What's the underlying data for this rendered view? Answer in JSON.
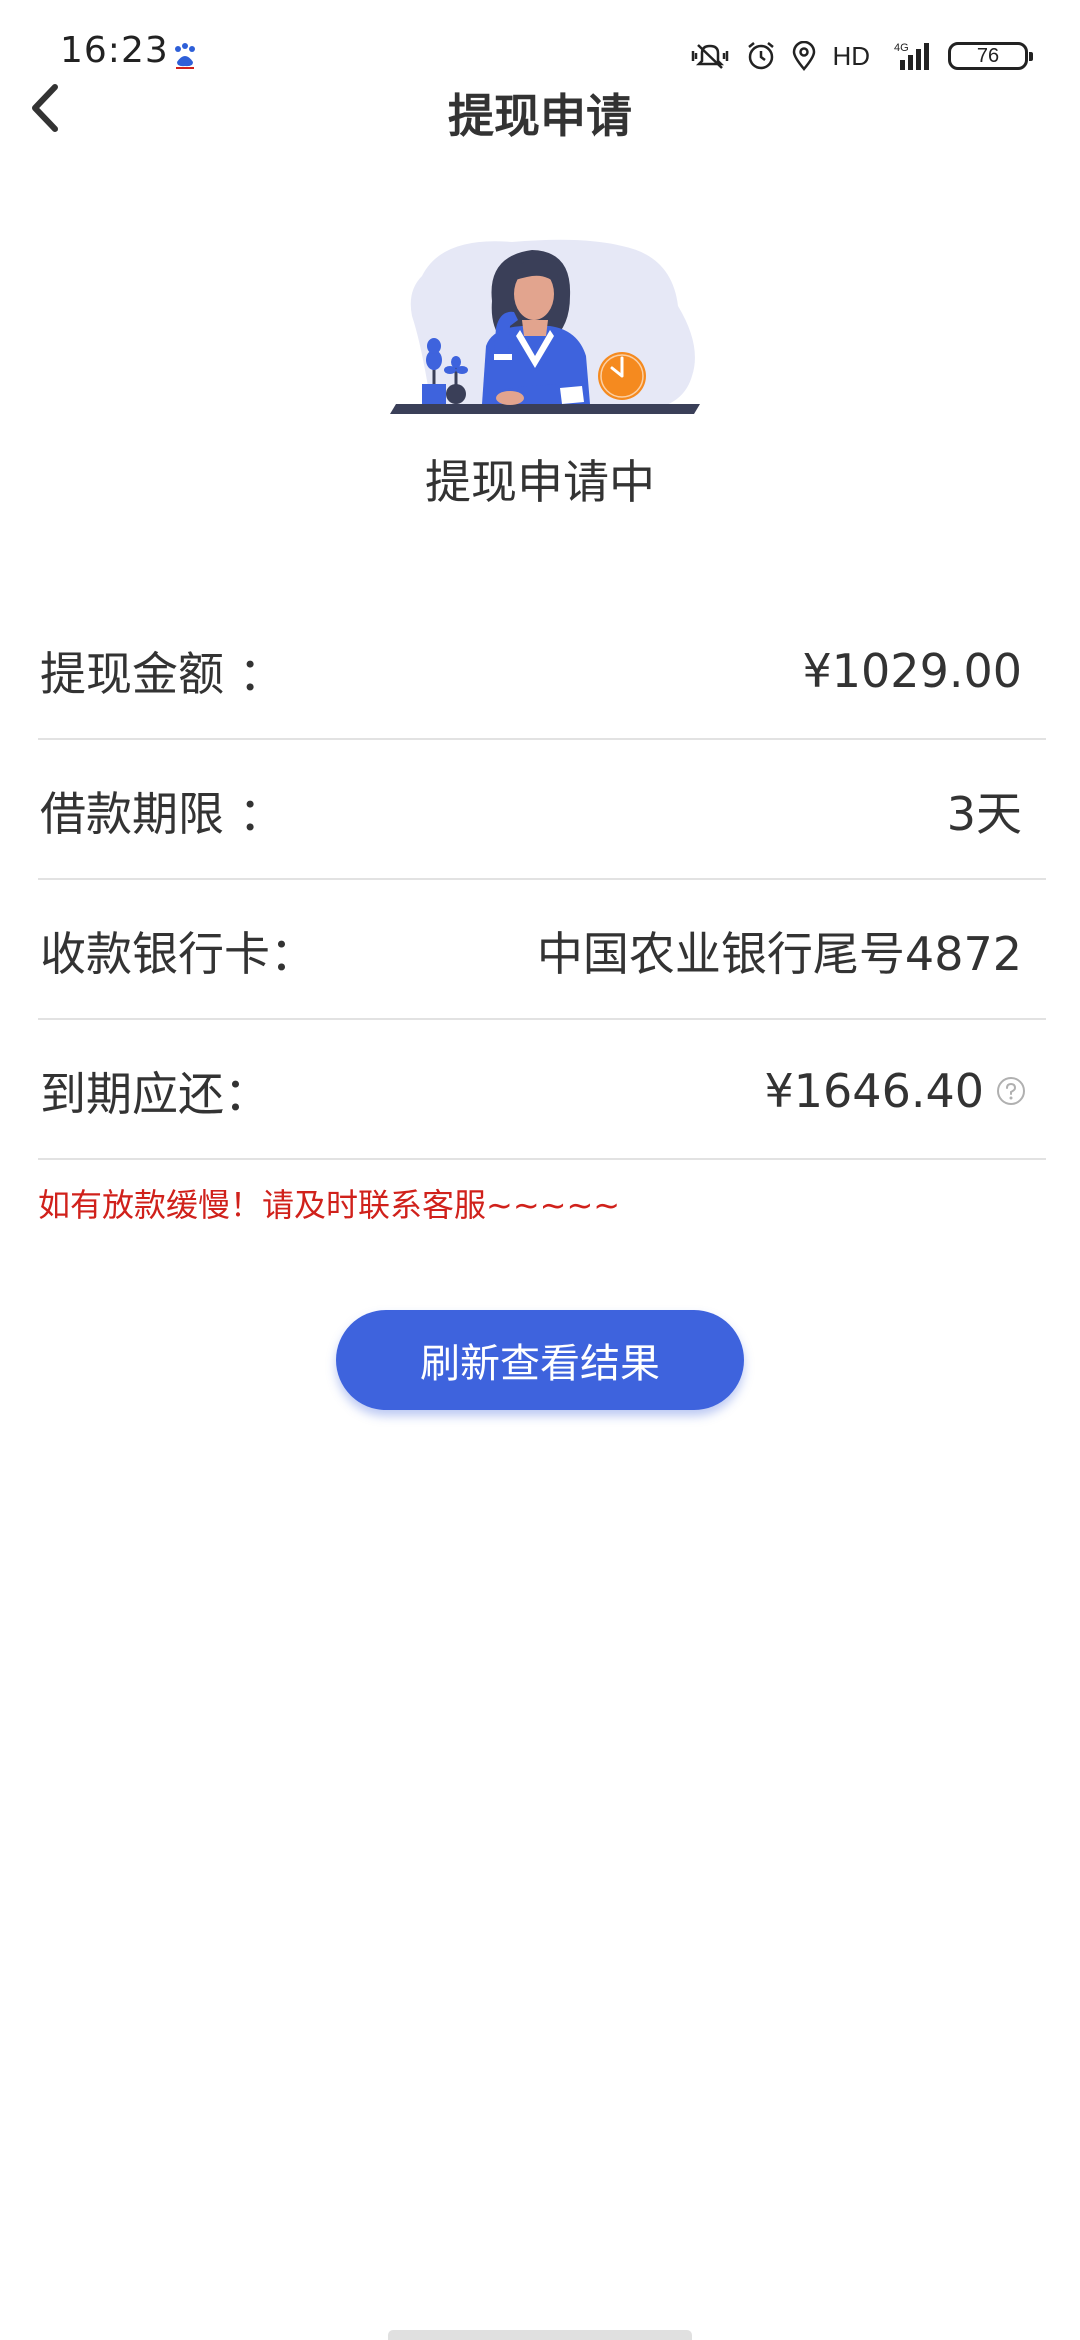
{
  "status_bar": {
    "time": "16:23",
    "hd": "HD",
    "network": "4G",
    "battery": "76"
  },
  "header": {
    "title": "提现申请"
  },
  "status": {
    "title": "提现申请中"
  },
  "info": [
    {
      "label": "提现金额 ：",
      "value": "¥1029.00"
    },
    {
      "label": "借款期限 ：",
      "value": "3天"
    },
    {
      "label": "收款银行卡：",
      "value": "中国农业银行尾号4872"
    },
    {
      "label": "到期应还：",
      "value": "¥1646.40"
    }
  ],
  "notice": "如有放款缓慢！请及时联系客服~~~~~",
  "refresh_button": "刷新查看结果",
  "colors": {
    "accent": "#3e63dd",
    "notice": "#d0211b",
    "clock_orange": "#f58a1f"
  }
}
